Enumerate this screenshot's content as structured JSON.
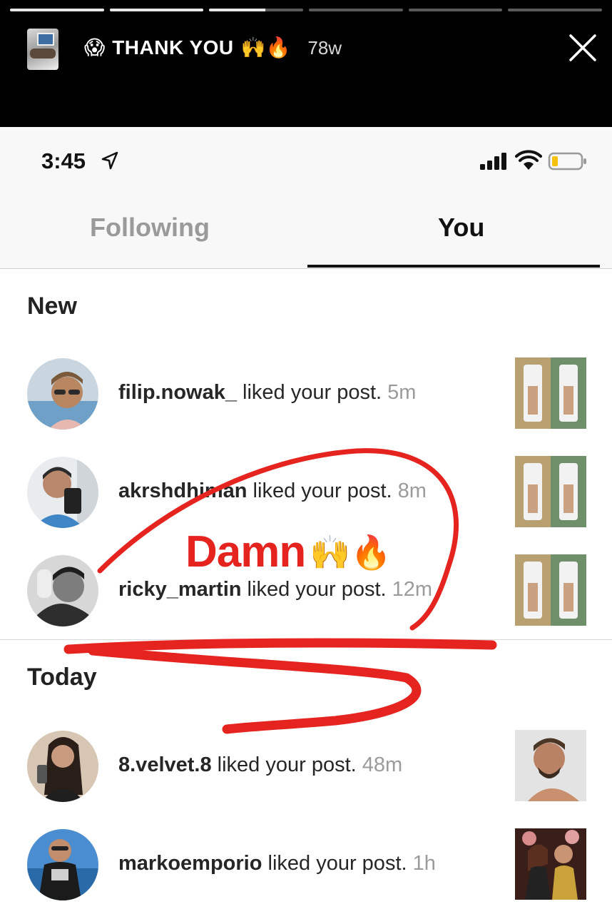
{
  "story": {
    "progress": [
      1,
      1,
      0.6,
      0,
      0,
      0
    ],
    "title_prefix_emoji": "😱",
    "title": "THANK YOU",
    "title_suffix_emoji": "🙌🔥",
    "age": "78w"
  },
  "status_bar": {
    "time": "3:45"
  },
  "tabs": [
    {
      "label": "Following",
      "active": false
    },
    {
      "label": "You",
      "active": true
    }
  ],
  "sections": {
    "new": "New",
    "today": "Today"
  },
  "notifications": [
    {
      "user": "filip.nowak_",
      "action": " liked your post. ",
      "time": "5m"
    },
    {
      "user": "akrshdhiman",
      "action": " liked your post. ",
      "time": "8m"
    },
    {
      "user": "ricky_martin",
      "action": " liked your post. ",
      "time": "12m"
    },
    {
      "user": "8.velvet.8",
      "action": " liked your post. ",
      "time": "48m"
    },
    {
      "user": "markoemporio",
      "action": " liked your post. ",
      "time": "1h"
    }
  ],
  "annotation": {
    "text": "Damn",
    "emoji": "🙌🔥"
  },
  "colors": {
    "scribble": "#e52420",
    "inactive_tab": "#9a9a9a"
  }
}
